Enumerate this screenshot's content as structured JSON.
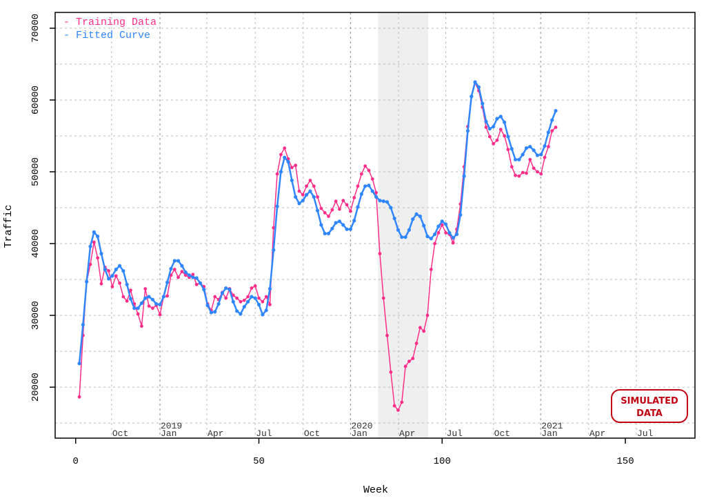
{
  "chart_data": {
    "type": "line",
    "title": "",
    "xlabel": "Week",
    "ylabel": "Traffic",
    "xlim": [
      -5.6,
      169
    ],
    "ylim": [
      12900,
      72200
    ],
    "grid": true,
    "legend_placement": "top-left",
    "x_ticks": [
      0,
      50,
      100,
      150
    ],
    "y_ticks": [
      20000,
      30000,
      40000,
      50000,
      60000,
      70000
    ],
    "y_grid_step": 5000,
    "date_ticks": [
      {
        "week": 9.8,
        "label": "Oct",
        "year": ""
      },
      {
        "week": 23.0,
        "label": "Jan",
        "year": "2019"
      },
      {
        "week": 35.8,
        "label": "Apr",
        "year": ""
      },
      {
        "week": 49.0,
        "label": "Jul",
        "year": ""
      },
      {
        "week": 62.1,
        "label": "Oct",
        "year": ""
      },
      {
        "week": 75.0,
        "label": "Jan",
        "year": "2020"
      },
      {
        "week": 88.1,
        "label": "Apr",
        "year": ""
      },
      {
        "week": 101.0,
        "label": "Jul",
        "year": ""
      },
      {
        "week": 114.0,
        "label": "Oct",
        "year": ""
      },
      {
        "week": 126.9,
        "label": "Jan",
        "year": "2021"
      },
      {
        "week": 140.0,
        "label": "Apr",
        "year": ""
      },
      {
        "week": 153.0,
        "label": "Jul",
        "year": ""
      }
    ],
    "shaded_region": {
      "x_start": 82.5,
      "x_end": 96.2,
      "color": "#efefef"
    },
    "series": [
      {
        "name": "Training Data",
        "color": "#ff2d8a",
        "x_start": 1,
        "values": [
          18650,
          27200,
          34700,
          37100,
          40200,
          38000,
          34400,
          36700,
          36200,
          34000,
          35500,
          34500,
          32600,
          32000,
          33500,
          31600,
          30200,
          28500,
          33700,
          31300,
          31000,
          31400,
          30100,
          32600,
          32700,
          35600,
          36400,
          35300,
          36100,
          35600,
          35300,
          35700,
          34300,
          34500,
          34000,
          31600,
          30700,
          32600,
          32200,
          33200,
          32400,
          33700,
          32800,
          32400,
          31900,
          32100,
          32600,
          33800,
          34100,
          32400,
          31900,
          32600,
          31500,
          42200,
          49700,
          52400,
          53300,
          51800,
          50600,
          50900,
          47300,
          46800,
          48000,
          48800,
          48000,
          46500,
          44900,
          44300,
          43800,
          44700,
          45900,
          44800,
          46000,
          45400,
          44500,
          46400,
          48000,
          49700,
          50800,
          50200,
          49000,
          47100,
          38600,
          32400,
          27200,
          22100,
          17400,
          16800,
          17900,
          22900,
          23600,
          24000,
          26100,
          28300,
          27800,
          30000,
          36400,
          40000,
          41500,
          42600,
          41500,
          41300,
          40100,
          42000,
          45500,
          50700,
          56300,
          60500,
          62400,
          61300,
          59000,
          56200,
          54900,
          53900,
          54400,
          55900,
          55000,
          53100,
          50700,
          49500,
          49400,
          49900,
          49800,
          51700,
          50500,
          50000,
          49700,
          52000,
          53500,
          55700,
          56200
        ]
      },
      {
        "name": "Fitted Curve",
        "color": "#2f86ff",
        "x_start": 1,
        "values": [
          23300,
          28700,
          34700,
          39600,
          41600,
          41000,
          38600,
          36400,
          35100,
          35500,
          36400,
          36900,
          36200,
          34300,
          32300,
          31000,
          31000,
          31700,
          32400,
          32600,
          32200,
          31600,
          31500,
          32600,
          34600,
          36500,
          37600,
          37600,
          36900,
          36000,
          35600,
          35300,
          35200,
          34500,
          33600,
          31400,
          30400,
          30500,
          31600,
          33100,
          33800,
          33600,
          31900,
          30600,
          30200,
          31200,
          31900,
          32600,
          32400,
          31500,
          30100,
          30700,
          33700,
          39100,
          45200,
          50000,
          52000,
          51400,
          48800,
          46500,
          45600,
          46000,
          46800,
          47300,
          46500,
          44600,
          42600,
          41400,
          41400,
          42100,
          42900,
          43100,
          42600,
          42000,
          42000,
          43200,
          45100,
          46900,
          48000,
          48100,
          47300,
          46500,
          46000,
          45900,
          45800,
          45000,
          43500,
          41900,
          40900,
          40900,
          41900,
          43400,
          44100,
          43800,
          42500,
          41000,
          40700,
          41300,
          42400,
          43100,
          42700,
          41500,
          40800,
          41300,
          44000,
          49400,
          55700,
          60500,
          62500,
          61800,
          59500,
          57000,
          56000,
          56300,
          57400,
          57700,
          56900,
          54900,
          53200,
          51700,
          51700,
          52400,
          53300,
          53500,
          53000,
          52300,
          52400,
          53600,
          55500,
          57200,
          58500
        ]
      }
    ],
    "legend": [
      {
        "label": "- Training Data",
        "color": "#ff2d8a"
      },
      {
        "label": "- Fitted Curve",
        "color": "#2f86ff"
      }
    ],
    "stamp": {
      "line1": "SIMULATED",
      "line2": "DATA",
      "color": "#c00010"
    }
  }
}
